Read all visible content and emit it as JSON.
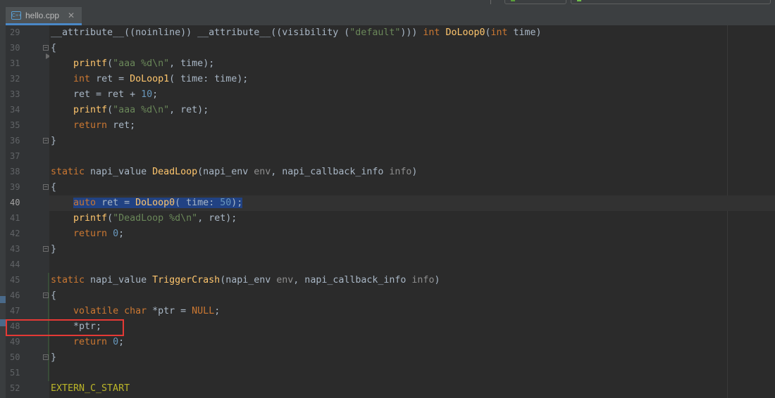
{
  "tab": {
    "icon": "cpp-file-icon",
    "title": "hello.cpp",
    "close": "✕"
  },
  "lines": [
    {
      "num": "29",
      "text": "__attribute__((noinline)) __attribute__((visibility (\"default\"))) int DoLoop0(int time)"
    },
    {
      "num": "30",
      "text": "{"
    },
    {
      "num": "31",
      "text": "    printf(\"aaa %d\\n\", time);"
    },
    {
      "num": "32",
      "text": "    int ret = DoLoop1( time: time);"
    },
    {
      "num": "33",
      "text": "    ret = ret + 10;"
    },
    {
      "num": "34",
      "text": "    printf(\"aaa %d\\n\", ret);"
    },
    {
      "num": "35",
      "text": "    return ret;"
    },
    {
      "num": "36",
      "text": "}"
    },
    {
      "num": "37",
      "text": ""
    },
    {
      "num": "38",
      "text": "static napi_value DeadLoop(napi_env env, napi_callback_info info)"
    },
    {
      "num": "39",
      "text": "{"
    },
    {
      "num": "40",
      "text": "    auto ret = DoLoop0( time: 50);"
    },
    {
      "num": "41",
      "text": "    printf(\"DeadLoop %d\\n\", ret);"
    },
    {
      "num": "42",
      "text": "    return 0;"
    },
    {
      "num": "43",
      "text": "}"
    },
    {
      "num": "44",
      "text": ""
    },
    {
      "num": "45",
      "text": "static napi_value TriggerCrash(napi_env env, napi_callback_info info)"
    },
    {
      "num": "46",
      "text": "{"
    },
    {
      "num": "47",
      "text": "    volatile char *ptr = NULL;"
    },
    {
      "num": "48",
      "text": "    *ptr;"
    },
    {
      "num": "49",
      "text": "    return 0;"
    },
    {
      "num": "50",
      "text": "}"
    },
    {
      "num": "51",
      "text": ""
    },
    {
      "num": "52",
      "text": "EXTERN_C_START"
    }
  ],
  "current_line": "40",
  "highlighted_line": "48",
  "colors": {
    "background": "#2b2b2b",
    "keyword": "#cc7832",
    "function": "#ffc66d",
    "string": "#6a8759",
    "number": "#6897bb",
    "selection": "#214283",
    "highlight_box": "#e53935"
  }
}
